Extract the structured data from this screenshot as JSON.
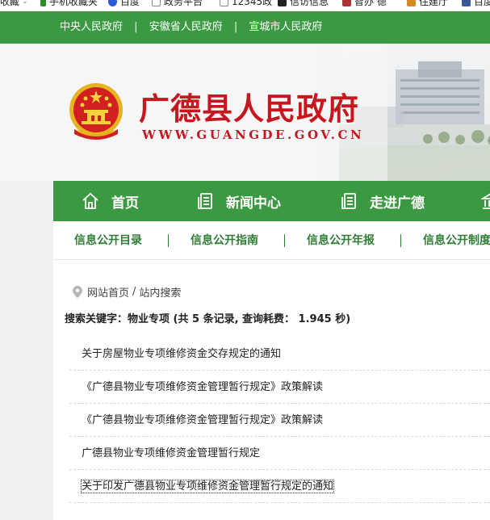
{
  "bookmarks": [
    {
      "label": "收藏",
      "icon": "chevron-down-icon",
      "color": "#999999"
    },
    {
      "label": "手机收藏夹",
      "icon": "phone-icon",
      "color": "#2a8f2a"
    },
    {
      "label": "百度",
      "icon": "paw-icon",
      "color": "#2a5bd7"
    },
    {
      "label": "政务平台",
      "icon": "page-icon",
      "color": "#888888"
    },
    {
      "label": "12345政",
      "icon": "page-icon",
      "color": "#888888"
    },
    {
      "label": "信访信息",
      "icon": "black-square-icon",
      "color": "#222222"
    },
    {
      "label": "智办 德",
      "icon": "app-icon",
      "color": "#aa3333"
    },
    {
      "label": "住建厅",
      "icon": "tag-icon",
      "color": "#d88a1e"
    },
    {
      "label": "百度",
      "icon": "facebook-icon",
      "color": "#3b5998"
    }
  ],
  "topbar": {
    "links": [
      "中央人民政府",
      "安徽省人民政府",
      "宣城市人民政府"
    ],
    "separator": "|"
  },
  "header": {
    "title": "广德县人民政府",
    "domain": "WWW.GUANGDE.GOV.CN"
  },
  "main_nav": [
    {
      "label": "首页",
      "icon": "home-icon"
    },
    {
      "label": "新闻中心",
      "icon": "news-icon"
    },
    {
      "label": "走进广德",
      "icon": "document-icon"
    },
    {
      "label": "",
      "icon": "building-icon"
    }
  ],
  "sub_nav": [
    "信息公开目录",
    "信息公开指南",
    "信息公开年报",
    "信息公开制度"
  ],
  "breadcrumb": {
    "home": "网站首页",
    "separator": "/",
    "current": "站内搜索"
  },
  "search_summary": "搜索关键字：物业专项 (共 5 条记录, 查询耗费： 1.945 秒)",
  "results": [
    "关于房屋物业专项维修资金交存规定的通知",
    "《广德县物业专项维修资金管理暂行规定》政策解读",
    "《广德县物业专项维修资金管理暂行规定》政策解读",
    "广德县物业专项维修资金管理暂行规定",
    "关于印发广德县物业专项维修资金管理暂行规定的通知"
  ],
  "colors": {
    "brand_green": "#3b9a41",
    "title_red": "#c7161d",
    "subnav_green": "#2f7d34"
  }
}
